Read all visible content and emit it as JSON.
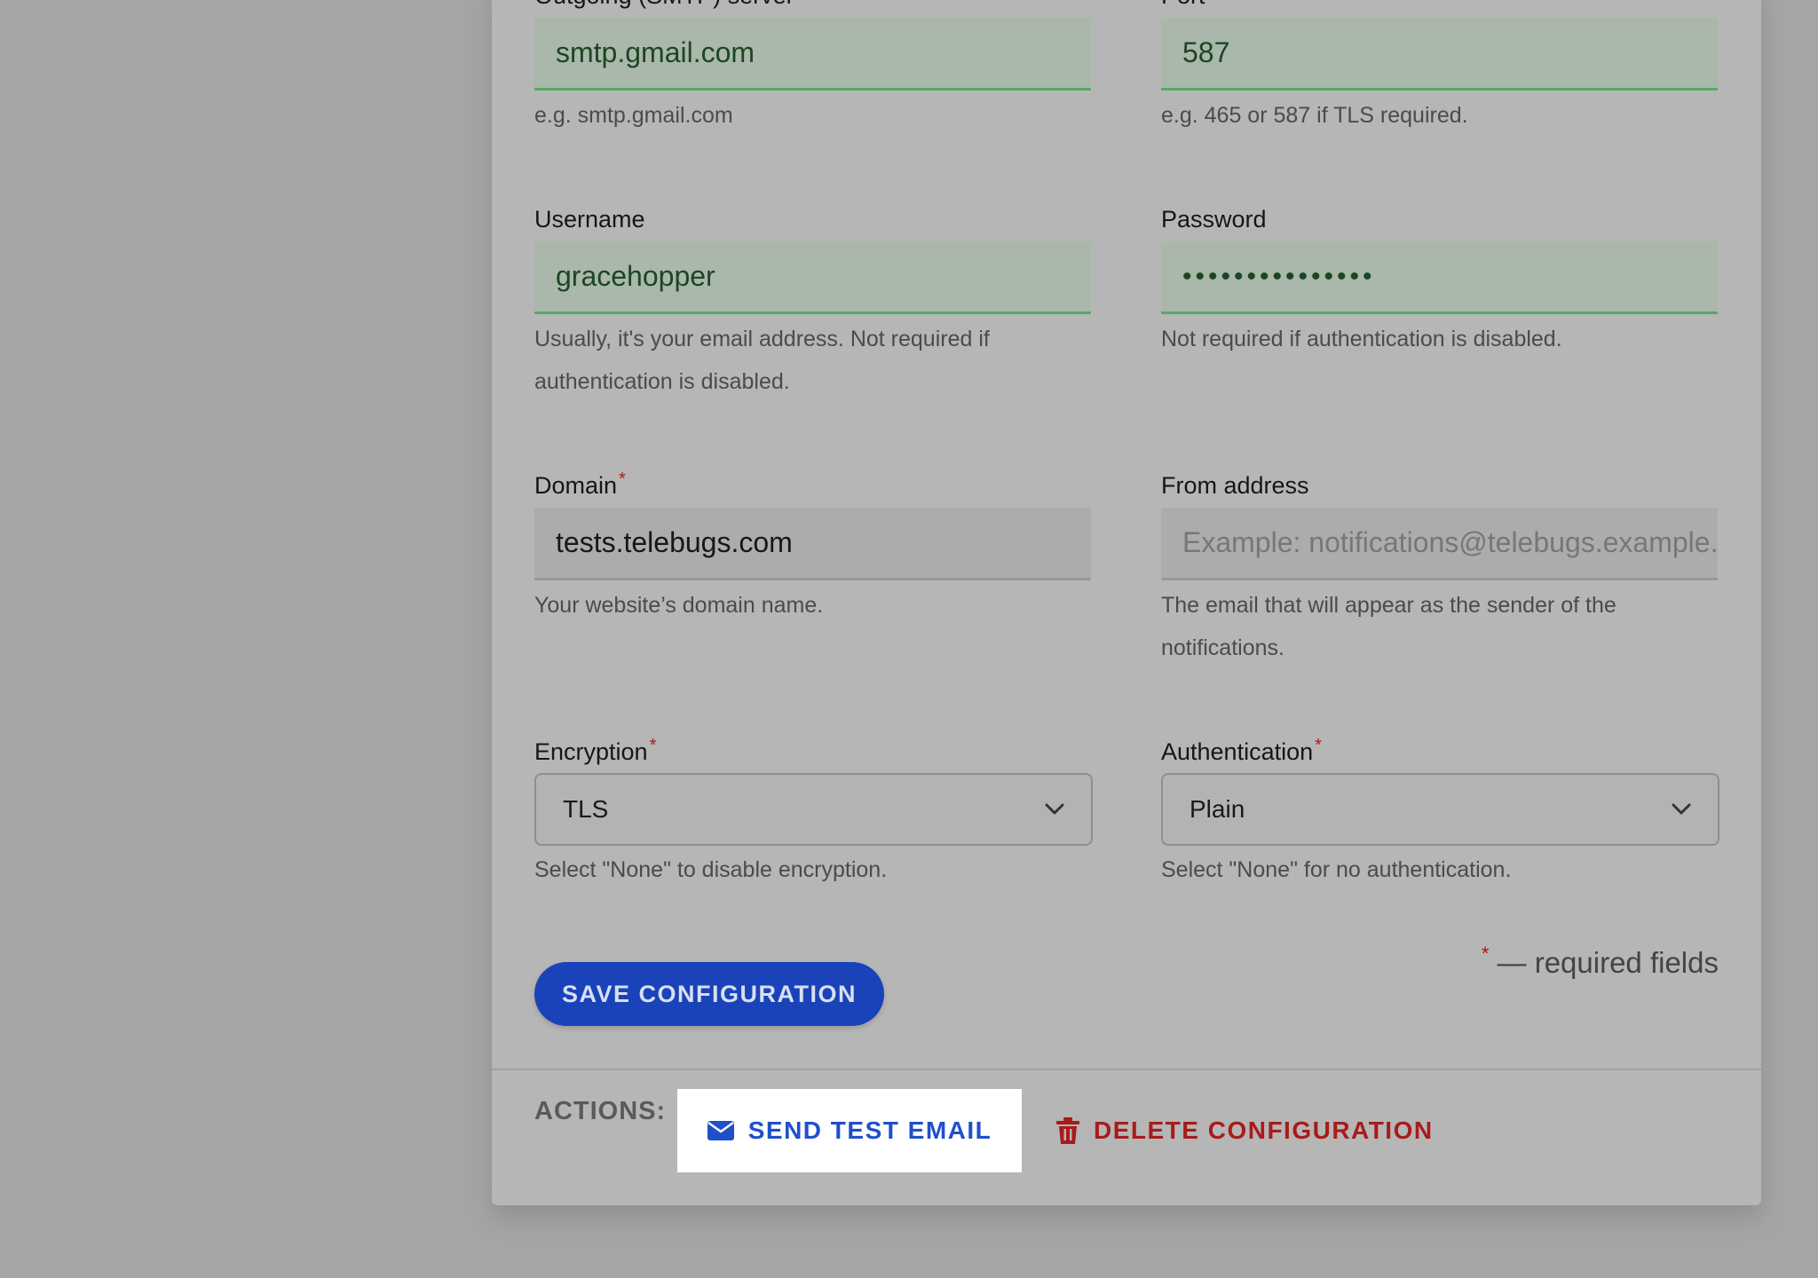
{
  "form": {
    "smtp_server": {
      "label": "Outgoing (SMTP) server",
      "value": "smtp.gmail.com",
      "help": "e.g. smtp.gmail.com"
    },
    "port": {
      "label": "Port",
      "value": "587",
      "help": "e.g. 465 or 587 if TLS required."
    },
    "username": {
      "label": "Username",
      "value": "gracehopper",
      "help": "Usually, it's your email address. Not required if authentication is disabled."
    },
    "password": {
      "label": "Password",
      "value": "•••••••••••••••",
      "help": "Not required if authentication is disabled."
    },
    "domain": {
      "label": "Domain",
      "required_mark": "*",
      "value": "tests.telebugs.com",
      "help": "Your website’s domain name."
    },
    "from_address": {
      "label": "From address",
      "placeholder": "Example: notifications@telebugs.example.com",
      "help": "The email that will appear as the sender of the notifications."
    },
    "encryption": {
      "label": "Encryption",
      "required_mark": "*",
      "selected": "TLS",
      "help": "Select \"None\" to disable encryption."
    },
    "authentication": {
      "label": "Authentication",
      "required_mark": "*",
      "selected": "Plain",
      "help": "Select \"None\" for no authentication."
    },
    "save_label": "SAVE CONFIGURATION",
    "required_legend": {
      "mark": "*",
      "text": " — required fields"
    }
  },
  "actions": {
    "label": "ACTIONS:",
    "send_test_email": "SEND TEST EMAIL",
    "delete_configuration": "DELETE CONFIGURATION"
  },
  "icons": {
    "send_test_email": "envelope-icon",
    "delete_configuration": "trash-icon",
    "select": "chevron-down-icon"
  },
  "colors": {
    "primary": "#1a43b9",
    "danger": "#a81b1b",
    "valid_border": "#58a866",
    "required": "#b51515"
  }
}
